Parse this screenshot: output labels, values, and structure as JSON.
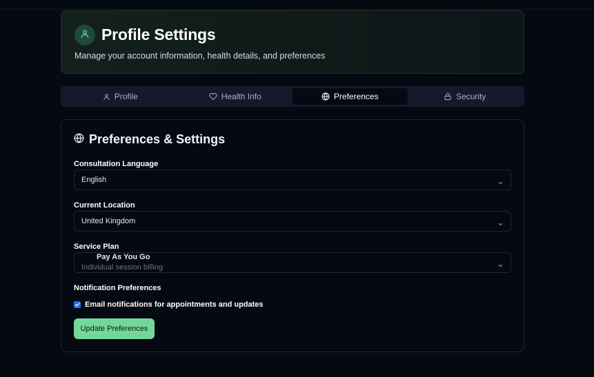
{
  "header": {
    "title": "Profile Settings",
    "subtitle": "Manage your account information, health details, and preferences",
    "avatar_icon": "user-icon"
  },
  "tabs": [
    {
      "label": "Profile",
      "icon": "user-icon",
      "active": false
    },
    {
      "label": "Health Info",
      "icon": "heart-icon",
      "active": false
    },
    {
      "label": "Preferences",
      "icon": "globe-icon",
      "active": true
    },
    {
      "label": "Security",
      "icon": "lock-icon",
      "active": false
    }
  ],
  "section": {
    "title": "Preferences & Settings",
    "icon": "globe-icon"
  },
  "fields": {
    "language": {
      "label": "Consultation Language",
      "value": "English"
    },
    "location": {
      "label": "Current Location",
      "value": "United Kingdom"
    },
    "plan": {
      "label": "Service Plan",
      "value": "Pay As You Go",
      "description": "Individual session billing"
    }
  },
  "notifications": {
    "label": "Notification Preferences",
    "email_checkbox_label": "Email notifications for appointments and updates",
    "email_checked": true
  },
  "actions": {
    "update_label": "Update Preferences"
  },
  "colors": {
    "accent": "#74d79a",
    "checkbox": "#1f6feb",
    "background": "#050912"
  }
}
